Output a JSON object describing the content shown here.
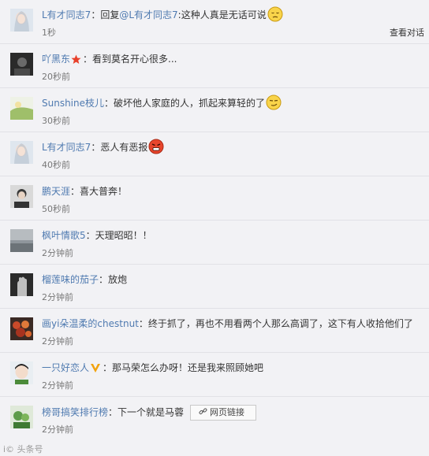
{
  "colors": {
    "username": "#4f7ab0",
    "background": "#f2f2f5"
  },
  "comments": [
    {
      "user": "L有才同志7",
      "prefix": "：回复",
      "mention": "@L有才同志7",
      "text": ":这种人真是无话可说",
      "emoji": "sigh-face-icon",
      "time": "1秒",
      "action": "查看对话"
    },
    {
      "user": "吖黑东",
      "badge": "red-star-icon",
      "text": "：看到莫名开心很多...",
      "time": "20秒前"
    },
    {
      "user": "Sunshine枝儿",
      "text": "：破坏他人家庭的人，抓起来算轻的了",
      "emoji": "smirk-face-icon",
      "time": "30秒前"
    },
    {
      "user": "L有才同志7",
      "text": "：恶人有恶报",
      "emoji": "angry-face-icon",
      "time": "40秒前"
    },
    {
      "user": "鹏天涯",
      "text": "：喜大普奔！",
      "time": "50秒前"
    },
    {
      "user": "枫叶情歌5",
      "text": "：天理昭昭！！",
      "time": "2分钟前"
    },
    {
      "user": "榴莲味的茄子",
      "text": "：放炮",
      "time": "2分钟前"
    },
    {
      "user": "画yi朵温柔的chestnut",
      "text": "：终于抓了，再也不用看两个人那么高调了，这下有人收拾他们了",
      "time": "2分钟前"
    },
    {
      "user": "一只好恋人",
      "badge": "v-verified-icon",
      "text": "：那马荣怎么办呀！还是我来照顾她吧",
      "time": "2分钟前"
    },
    {
      "user": "榜哥搞笑排行榜",
      "text": "：下一个就是马蓉",
      "link_label": "网页链接",
      "time": "2分钟前"
    }
  ],
  "watermark": "i© 头条号"
}
